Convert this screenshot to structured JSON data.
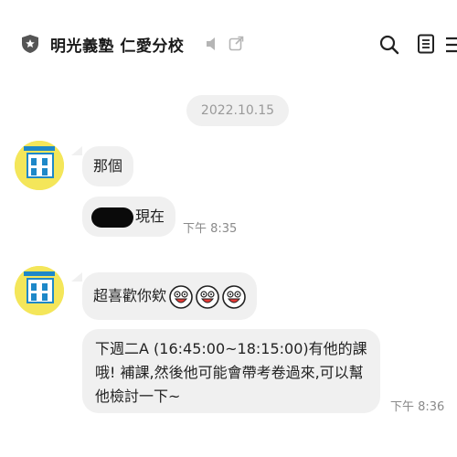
{
  "header": {
    "title": "明光義塾 仁愛分校",
    "icons": [
      "shield-icon",
      "mute-icon",
      "external-link-icon",
      "search-icon",
      "notes-icon",
      "menu-icon"
    ]
  },
  "chat": {
    "date": "2022.10.15",
    "messages": [
      {
        "text": "那個",
        "time": ""
      },
      {
        "text": "現在",
        "time": "下午 8:35"
      },
      {
        "text": "超喜歡你欸",
        "time": ""
      },
      {
        "text": "下週二A (16:45:00~18:15:00)有他的課哦! 補課,然後他可能會帶考卷過來,可以幫他檢討一下~",
        "time": "下午 8:36"
      }
    ]
  },
  "colors": {
    "bubble": "#f0f0f0",
    "avatar": "#f4e65a",
    "time": "#8a8a8a"
  }
}
